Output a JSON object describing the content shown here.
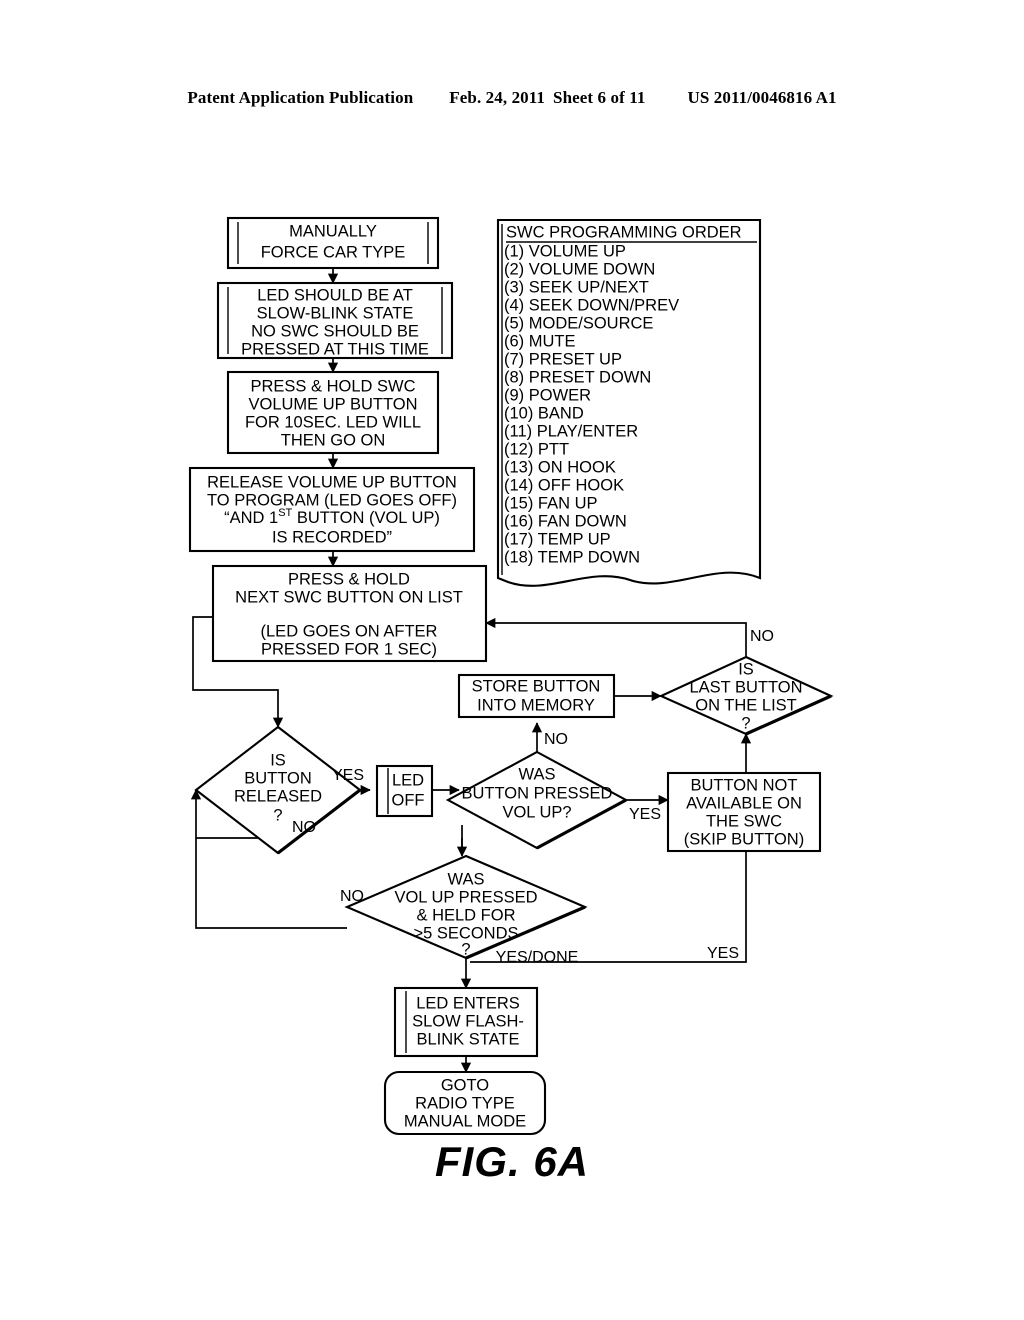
{
  "header": {
    "left": "Patent Application Publication",
    "date": "Feb. 24, 2011",
    "sheet": "Sheet 6 of 11",
    "pubnum": "US 2011/0046816 A1"
  },
  "figure_label": "FIG. 6A",
  "swc_list": {
    "title": "SWC PROGRAMMING ORDER",
    "items": [
      "(1) VOLUME UP",
      "(2) VOLUME DOWN",
      "(3) SEEK UP/NEXT",
      "(4) SEEK DOWN/PREV",
      "(5) MODE/SOURCE",
      "(6) MUTE",
      "(7) PRESET UP",
      "(8) PRESET DOWN",
      "(9) POWER",
      "(10) BAND",
      "(11) PLAY/ENTER",
      "(12) PTT",
      "(13) ON HOOK",
      "(14) OFF HOOK",
      "(15) FAN UP",
      "(16) FAN DOWN",
      "(17) TEMP UP",
      "(18) TEMP DOWN"
    ]
  },
  "nodes": {
    "manually_force": {
      "lines": [
        "MANUALLY",
        "FORCE CAR TYPE"
      ]
    },
    "led_slow_blink": {
      "lines": [
        "LED SHOULD BE AT",
        "SLOW-BLINK STATE",
        "NO SWC SHOULD BE",
        "PRESSED AT THIS TIME"
      ]
    },
    "press_hold_volup": {
      "lines": [
        "PRESS & HOLD SWC",
        "VOLUME UP BUTTON",
        "FOR 10SEC. LED WILL",
        "THEN GO ON"
      ]
    },
    "release_volup": {
      "line1": "RELEASE VOLUME UP BUTTON",
      "line2": "TO PROGRAM (LED GOES OFF)",
      "line3_a": "“AND 1",
      "line3_sup": "ST",
      "line3_b": " BUTTON (VOL UP)",
      "line4": "IS RECORDED”"
    },
    "press_hold_next": {
      "lines": [
        "PRESS & HOLD",
        "NEXT SWC BUTTON ON LIST",
        "",
        "(LED GOES ON AFTER",
        "PRESSED FOR 1 SEC)"
      ]
    },
    "is_button_released": {
      "lines": [
        "IS",
        "BUTTON",
        "RELEASED",
        "?"
      ]
    },
    "led_off": {
      "lines": [
        "LED",
        "OFF"
      ]
    },
    "was_button_pressed": {
      "lines": [
        "WAS",
        "BUTTON PRESSED",
        "VOL UP?"
      ]
    },
    "store_button": {
      "lines": [
        "STORE BUTTON",
        "INTO MEMORY"
      ]
    },
    "is_last_button": {
      "lines": [
        "IS",
        "LAST BUTTON",
        "ON THE LIST",
        "?"
      ]
    },
    "button_not_available": {
      "lines": [
        "BUTTON NOT",
        "AVAILABLE ON",
        "THE SWC",
        "(SKIP BUTTON)"
      ]
    },
    "was_volup_held": {
      "lines": [
        "WAS",
        "VOL UP PRESSED",
        "& HELD FOR",
        ">5 SECONDS",
        "?"
      ]
    },
    "led_enters_flash": {
      "lines": [
        "LED ENTERS",
        "SLOW FLASH-",
        "BLINK STATE"
      ]
    },
    "goto_radio": {
      "lines": [
        "GOTO",
        "RADIO TYPE",
        "MANUAL MODE"
      ]
    }
  },
  "edge_labels": {
    "released_yes": "YES",
    "released_no": "NO",
    "pressed_no": "NO",
    "pressed_yes": "YES",
    "last_no": "NO",
    "skip_yes": "YES",
    "held_no": "NO",
    "held_yes_done": "YES/DONE"
  },
  "colors": {
    "ink": "#000000",
    "paper": "#ffffff"
  }
}
